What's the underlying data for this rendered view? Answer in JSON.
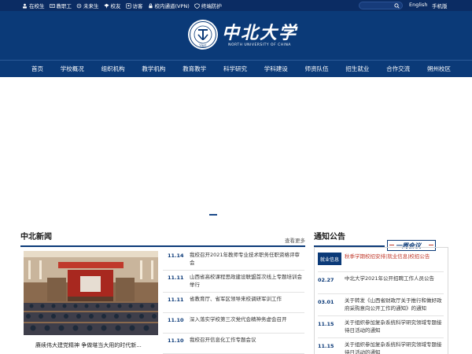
{
  "topbar": {
    "links": [
      {
        "label": "在校生",
        "icon": "student-icon"
      },
      {
        "label": "教职工",
        "icon": "staff-icon"
      },
      {
        "label": "未来生",
        "icon": "future-student-icon"
      },
      {
        "label": "校友",
        "icon": "alumni-icon"
      },
      {
        "label": "访客",
        "icon": "visitor-icon"
      },
      {
        "label": "校内通道(VPN)",
        "icon": "vpn-icon"
      },
      {
        "label": "终端防护",
        "icon": "shield-icon"
      }
    ],
    "search_icon": "search-icon",
    "english_label": "English",
    "mobile_label": "手机版"
  },
  "header": {
    "logo_cn": "中北大学",
    "logo_en": "NORTH UNIVERSITY OF CHINA",
    "seal_text": "1941"
  },
  "nav": {
    "items": [
      "首页",
      "学校概况",
      "组织机构",
      "教学机构",
      "教育教学",
      "科学研究",
      "学科建设",
      "师资队伍",
      "招生就业",
      "合作交流",
      "朔州校区"
    ]
  },
  "news": {
    "title": "中北新闻",
    "more": "查看更多",
    "photo_caption": "赓续伟大建党精神 争做堪当大用的时代新...",
    "items": [
      {
        "date": "11.14",
        "title": "我校召开2021年教师专业技术职务任职资格评审会"
      },
      {
        "date": "11.11",
        "title": "山西省高校课程思政建设联盟首次线上专题培训会举行"
      },
      {
        "date": "11.11",
        "title": "省教育厅、省军区领导来校调研军训工作"
      },
      {
        "date": "11.10",
        "title": "深入落实学校第三次党代会精神务虚会召开"
      },
      {
        "date": "11.10",
        "title": "我校召开信息化工作专题会议"
      }
    ]
  },
  "notices": {
    "title": "通知公告",
    "badge": "一周会议",
    "items": [
      {
        "date": "就业信息",
        "title": "秋季学期校招安排|就业信息|校招公告",
        "highlight": true
      },
      {
        "date": "02.27",
        "title": "中北大学2021年公开招聘工作人员公告",
        "highlight": false
      },
      {
        "date": "03.01",
        "title": "关于转发《山西省财政厅关于推行和做好政府采购意向公开工作的通知》的通知",
        "highlight": false
      },
      {
        "date": "11.15",
        "title": "关于组织参加复杂系统科学研究领域专题接待日活动的通知",
        "highlight": false
      },
      {
        "date": "11.15",
        "title": "关于组织参加复杂系统科学研究领域专题接待日活动的通知",
        "highlight": false
      }
    ]
  },
  "colors": {
    "primary": "#0b3a78",
    "topbar": "#0b2c63",
    "accent_red": "#c0392b"
  }
}
